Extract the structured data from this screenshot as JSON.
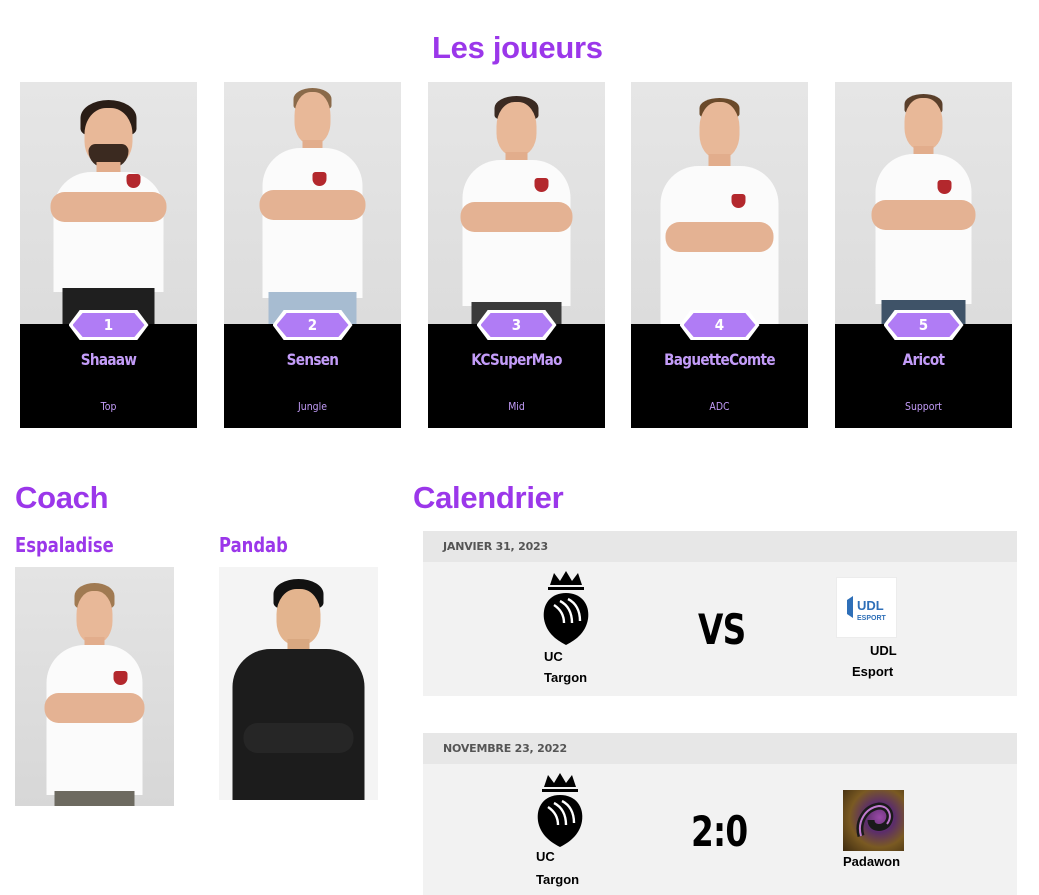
{
  "players_section": {
    "title": "Les joueurs",
    "players": [
      {
        "number": "1",
        "name": "Shaaaw",
        "role": "Top"
      },
      {
        "number": "2",
        "name": "Sensen",
        "role": "Jungle"
      },
      {
        "number": "3",
        "name": "KCSuperMao",
        "role": "Mid"
      },
      {
        "number": "4",
        "name": "BaguetteComte",
        "role": "ADC"
      },
      {
        "number": "5",
        "name": "Aricot",
        "role": "Support"
      }
    ]
  },
  "coach_section": {
    "title": "Coach",
    "coaches": [
      {
        "name": "Espaladise"
      },
      {
        "name": "Pandab"
      }
    ]
  },
  "calendar_section": {
    "title": "Calendrier",
    "matches": [
      {
        "date": "JANVIER 31, 2023",
        "home_team_line1": "UC",
        "home_team_line2": "Targon",
        "result": "VS",
        "away_team_line1": "UDL",
        "away_team_line2": "Esport",
        "away_logo": "udl-esport-logo"
      },
      {
        "date": "NOVEMBRE 23, 2022",
        "home_team_line1": "UC",
        "home_team_line2": "Targon",
        "result": "2:0",
        "away_team_line1": "Padawon",
        "away_logo": "padawon-logo"
      }
    ]
  },
  "colors": {
    "accent_purple": "#9b37ea",
    "light_purple": "#c39cf8",
    "number_badge": "#b07cf5",
    "card_black": "#000000",
    "match_bg": "#f2f2f2"
  }
}
